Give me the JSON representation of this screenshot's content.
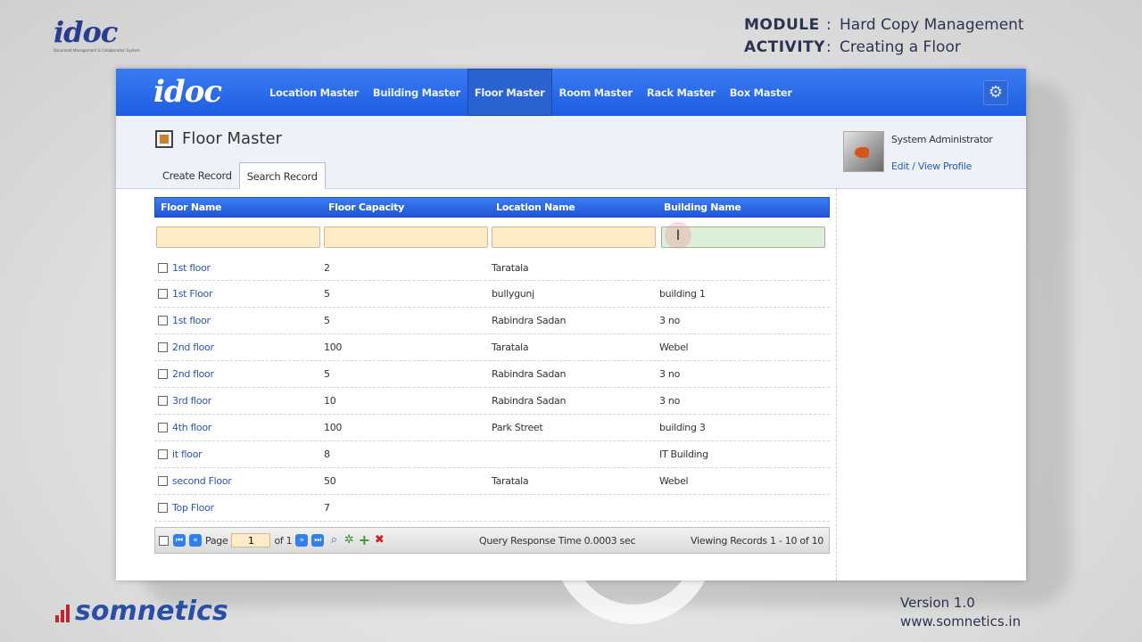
{
  "slide": {
    "logo_text": "idoc",
    "logo_tagline": "Document Management & Collaboration System",
    "module_label": "MODULE",
    "module_colon": ":",
    "module_value": "Hard Copy Management",
    "activity_label": "ACTIVITY",
    "activity_colon": ":",
    "activity_value": "Creating a Floor",
    "footer_brand": "somnetics",
    "version": "Version 1.0",
    "website": "www.somnetics.in"
  },
  "app": {
    "logo_text": "idoc",
    "nav": [
      {
        "label": "Location Master"
      },
      {
        "label": "Building Master"
      },
      {
        "label": "Floor Master",
        "active": true
      },
      {
        "label": "Room Master"
      },
      {
        "label": "Rack Master"
      },
      {
        "label": "Box Master"
      }
    ],
    "settings_icon": "gear-icon",
    "page_title": "Floor Master",
    "tabs": [
      {
        "label": "Create Record"
      },
      {
        "label": "Search Record",
        "active": true
      }
    ],
    "user": {
      "name": "System Administrator",
      "profile_link": "Edit / View Profile"
    }
  },
  "grid": {
    "columns": [
      "Floor Name",
      "Floor Capacity",
      "Location Name",
      "Building Name"
    ],
    "rows": [
      {
        "floor_name": "1st floor",
        "capacity": "2",
        "location": "Taratala",
        "building": ""
      },
      {
        "floor_name": "1st Floor",
        "capacity": "5",
        "location": "bullygunj",
        "building": "building 1"
      },
      {
        "floor_name": "1st floor",
        "capacity": "5",
        "location": "Rabindra Sadan",
        "building": "3 no"
      },
      {
        "floor_name": "2nd floor",
        "capacity": "100",
        "location": "Taratala",
        "building": "Webel"
      },
      {
        "floor_name": "2nd floor",
        "capacity": "5",
        "location": "Rabindra Sadan",
        "building": "3 no"
      },
      {
        "floor_name": "3rd floor",
        "capacity": "10",
        "location": "Rabindra Sadan",
        "building": "3 no"
      },
      {
        "floor_name": "4th floor",
        "capacity": "100",
        "location": "Park Street",
        "building": "building 3"
      },
      {
        "floor_name": "it floor",
        "capacity": "8",
        "location": "",
        "building": "IT Building"
      },
      {
        "floor_name": "second Floor",
        "capacity": "50",
        "location": "Taratala",
        "building": "Webel"
      },
      {
        "floor_name": "Top Floor",
        "capacity": "7",
        "location": "",
        "building": ""
      }
    ],
    "pager": {
      "page_label": "Page",
      "page_value": "1",
      "of_label": "of 1",
      "query_time": "Query Response Time 0.0003 sec",
      "viewing": "Viewing Records 1 - 10 of 10"
    }
  },
  "colors": {
    "accent": "#2a62e0",
    "filter_bg": "#fdebc8",
    "active_filter_bg": "#dcefd9"
  }
}
